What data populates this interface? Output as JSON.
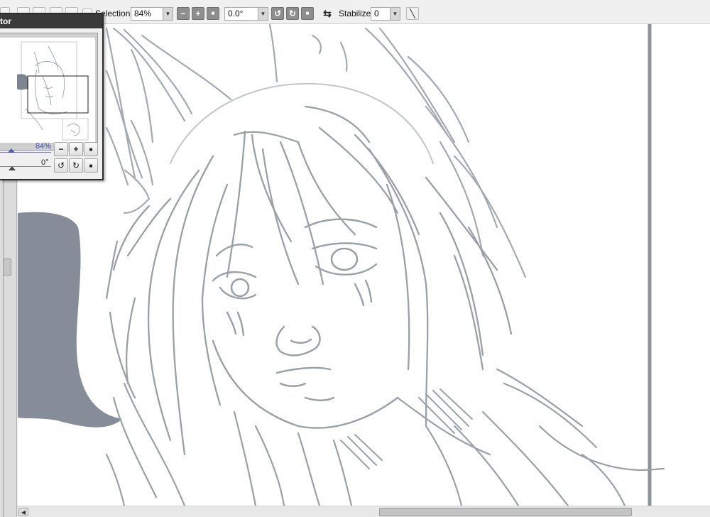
{
  "toolbar": {
    "selection_label": "Selection",
    "zoom_value": "84%",
    "rotation_value": "0.0°",
    "stabilizer_label": "Stabilizer",
    "stabilizer_value": "0",
    "zoom_out_icon": "minus-icon",
    "zoom_in_icon": "plus-icon",
    "zoom_reset_icon": "square-icon",
    "rotate_left_icon": "rotate-ccw-icon",
    "rotate_right_icon": "rotate-cw-icon",
    "rotate_reset_icon": "square-icon",
    "flip_icon": "flip-horizontal-icon",
    "pen_icon": "line-tool-icon",
    "zoom_out_glyph": "−",
    "zoom_in_glyph": "+",
    "reset_glyph": "■",
    "rotate_left_glyph": "↺",
    "rotate_right_glyph": "↻",
    "flip_glyph": "⇆",
    "dropdown_glyph": "▼",
    "line_glyph": "╲"
  },
  "navigator": {
    "title": "tor",
    "zoom": "84%",
    "rotation": "0°",
    "zoom_out_glyph": "−",
    "zoom_in_glyph": "+",
    "reset_glyph": "■",
    "rotate_left_glyph": "↺",
    "rotate_right_glyph": "↻"
  },
  "scrollbar": {
    "left_arrow_glyph": "◀"
  },
  "colors": {
    "sketch_line": "#9aa0a6",
    "fill_shape": "#868d98",
    "background": "#f0f0f0",
    "canvas": "#ffffff"
  }
}
